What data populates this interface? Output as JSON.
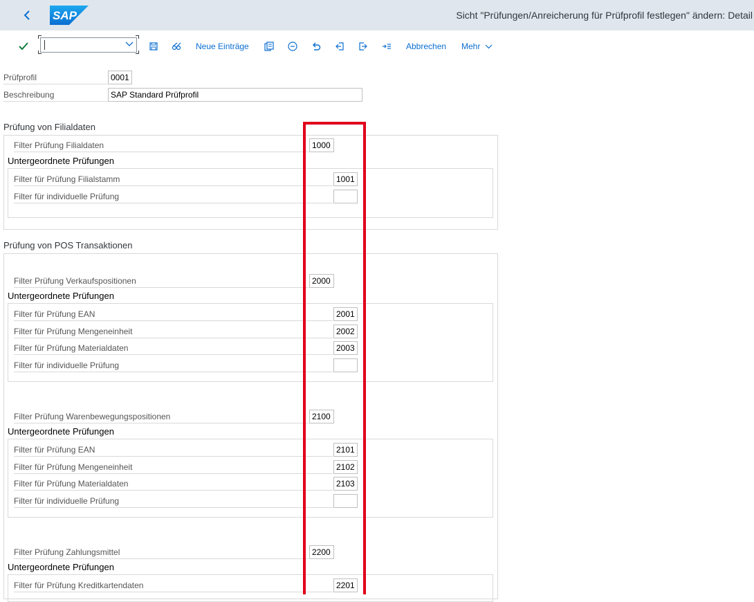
{
  "shell": {
    "back_icon": "chevron-left-icon",
    "logo_text": "SAP",
    "title": "Sicht \"Prüfungen/Anreicherung für Prüfprofil festlegen\" ändern: Detail"
  },
  "toolbar": {
    "command_value": "",
    "neue_eintraege": "Neue Einträge",
    "abbrechen": "Abbrechen",
    "mehr": "Mehr",
    "icons": [
      "check-icon",
      "save-icon",
      "glasses-icon",
      "copy-icon",
      "delete-icon",
      "undo-icon",
      "previous-icon",
      "next-icon",
      "goto-icon",
      "chevron-down-icon"
    ]
  },
  "header_fields": {
    "pruefprofil_label": "Prüfprofil",
    "pruefprofil_value": "0001",
    "beschreibung_label": "Beschreibung",
    "beschreibung_value": "SAP Standard Prüfprofil"
  },
  "filialdaten": {
    "title": "Prüfung von Filialdaten",
    "main_label": "Filter Prüfung Filialdaten",
    "main_value": "1000",
    "sub_title": "Untergeordnete Prüfungen",
    "rows": [
      {
        "label": "Filter für Prüfung Filialstamm",
        "value": "1001"
      },
      {
        "label": "Filter für individuelle Prüfung",
        "value": ""
      }
    ]
  },
  "pos": {
    "title": "Prüfung von POS Transaktionen",
    "groups": [
      {
        "main_label": "Filter Prüfung Verkaufspositionen",
        "main_value": "2000",
        "sub_title": "Untergeordnete Prüfungen",
        "rows": [
          {
            "label": "Filter für Prüfung EAN",
            "value": "2001"
          },
          {
            "label": "Filter für Prüfung Mengeneinheit",
            "value": "2002"
          },
          {
            "label": "Filter für Prüfung Materialdaten",
            "value": "2003"
          },
          {
            "label": "Filter für individuelle Prüfung",
            "value": ""
          }
        ]
      },
      {
        "main_label": "Filter Prüfung Warenbewegungspositionen",
        "main_value": "2100",
        "sub_title": "Untergeordnete Prüfungen",
        "rows": [
          {
            "label": "Filter für Prüfung EAN",
            "value": "2101"
          },
          {
            "label": "Filter für Prüfung Mengeneinheit",
            "value": "2102"
          },
          {
            "label": "Filter für Prüfung Materialdaten",
            "value": "2103"
          },
          {
            "label": "Filter für individuelle Prüfung",
            "value": ""
          }
        ]
      },
      {
        "main_label": "Filter Prüfung Zahlungsmittel",
        "main_value": "2200",
        "sub_title": "Untergeordnete Prüfungen",
        "rows": [
          {
            "label": "Filter für Prüfung Kreditkartendaten",
            "value": "2201"
          }
        ]
      }
    ]
  },
  "colors": {
    "accent": "#0a6ed1",
    "shell_bg": "#dfe6ee",
    "highlight": "#e0001b",
    "ok_green": "#107e3e"
  }
}
